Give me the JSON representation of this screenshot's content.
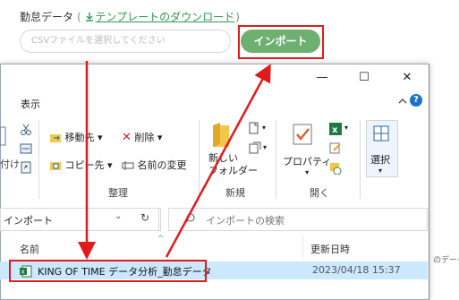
{
  "web_form": {
    "title": "勤怠データ",
    "paren_open": "(",
    "paren_close": ")",
    "template_link": "テンプレートのダウンロード",
    "csv_placeholder": "CSVファイルを選択してください",
    "import_button": "インポート"
  },
  "explorer": {
    "minimize": "—",
    "maximize": "☐",
    "close": "✕",
    "menu_view": "表示",
    "help": "?",
    "ribbon": {
      "cut_partial": "付け",
      "move_to": "移動先",
      "copy_to": "コピー先",
      "delete": "削除",
      "rename": "名前の変更",
      "new_folder_line1": "新しい",
      "new_folder_line2": "フォルダー",
      "properties": "プロパティ",
      "select": "選択",
      "group_organize": "整理",
      "group_new": "新規",
      "group_open": "開く"
    },
    "address": "インポート",
    "search_placeholder": "インポートの検索",
    "columns": {
      "name": "名前",
      "modified": "更新日時"
    },
    "file": {
      "name": "KING OF TIME データ分析_勤怠データ",
      "date": "2023/04/18 15:37"
    }
  },
  "background_text": "のデータ",
  "colors": {
    "accent_green": "#6db070",
    "highlight_red": "#e11b1b",
    "link_green": "#2e9a4e",
    "selection_blue": "#cce8ff"
  }
}
